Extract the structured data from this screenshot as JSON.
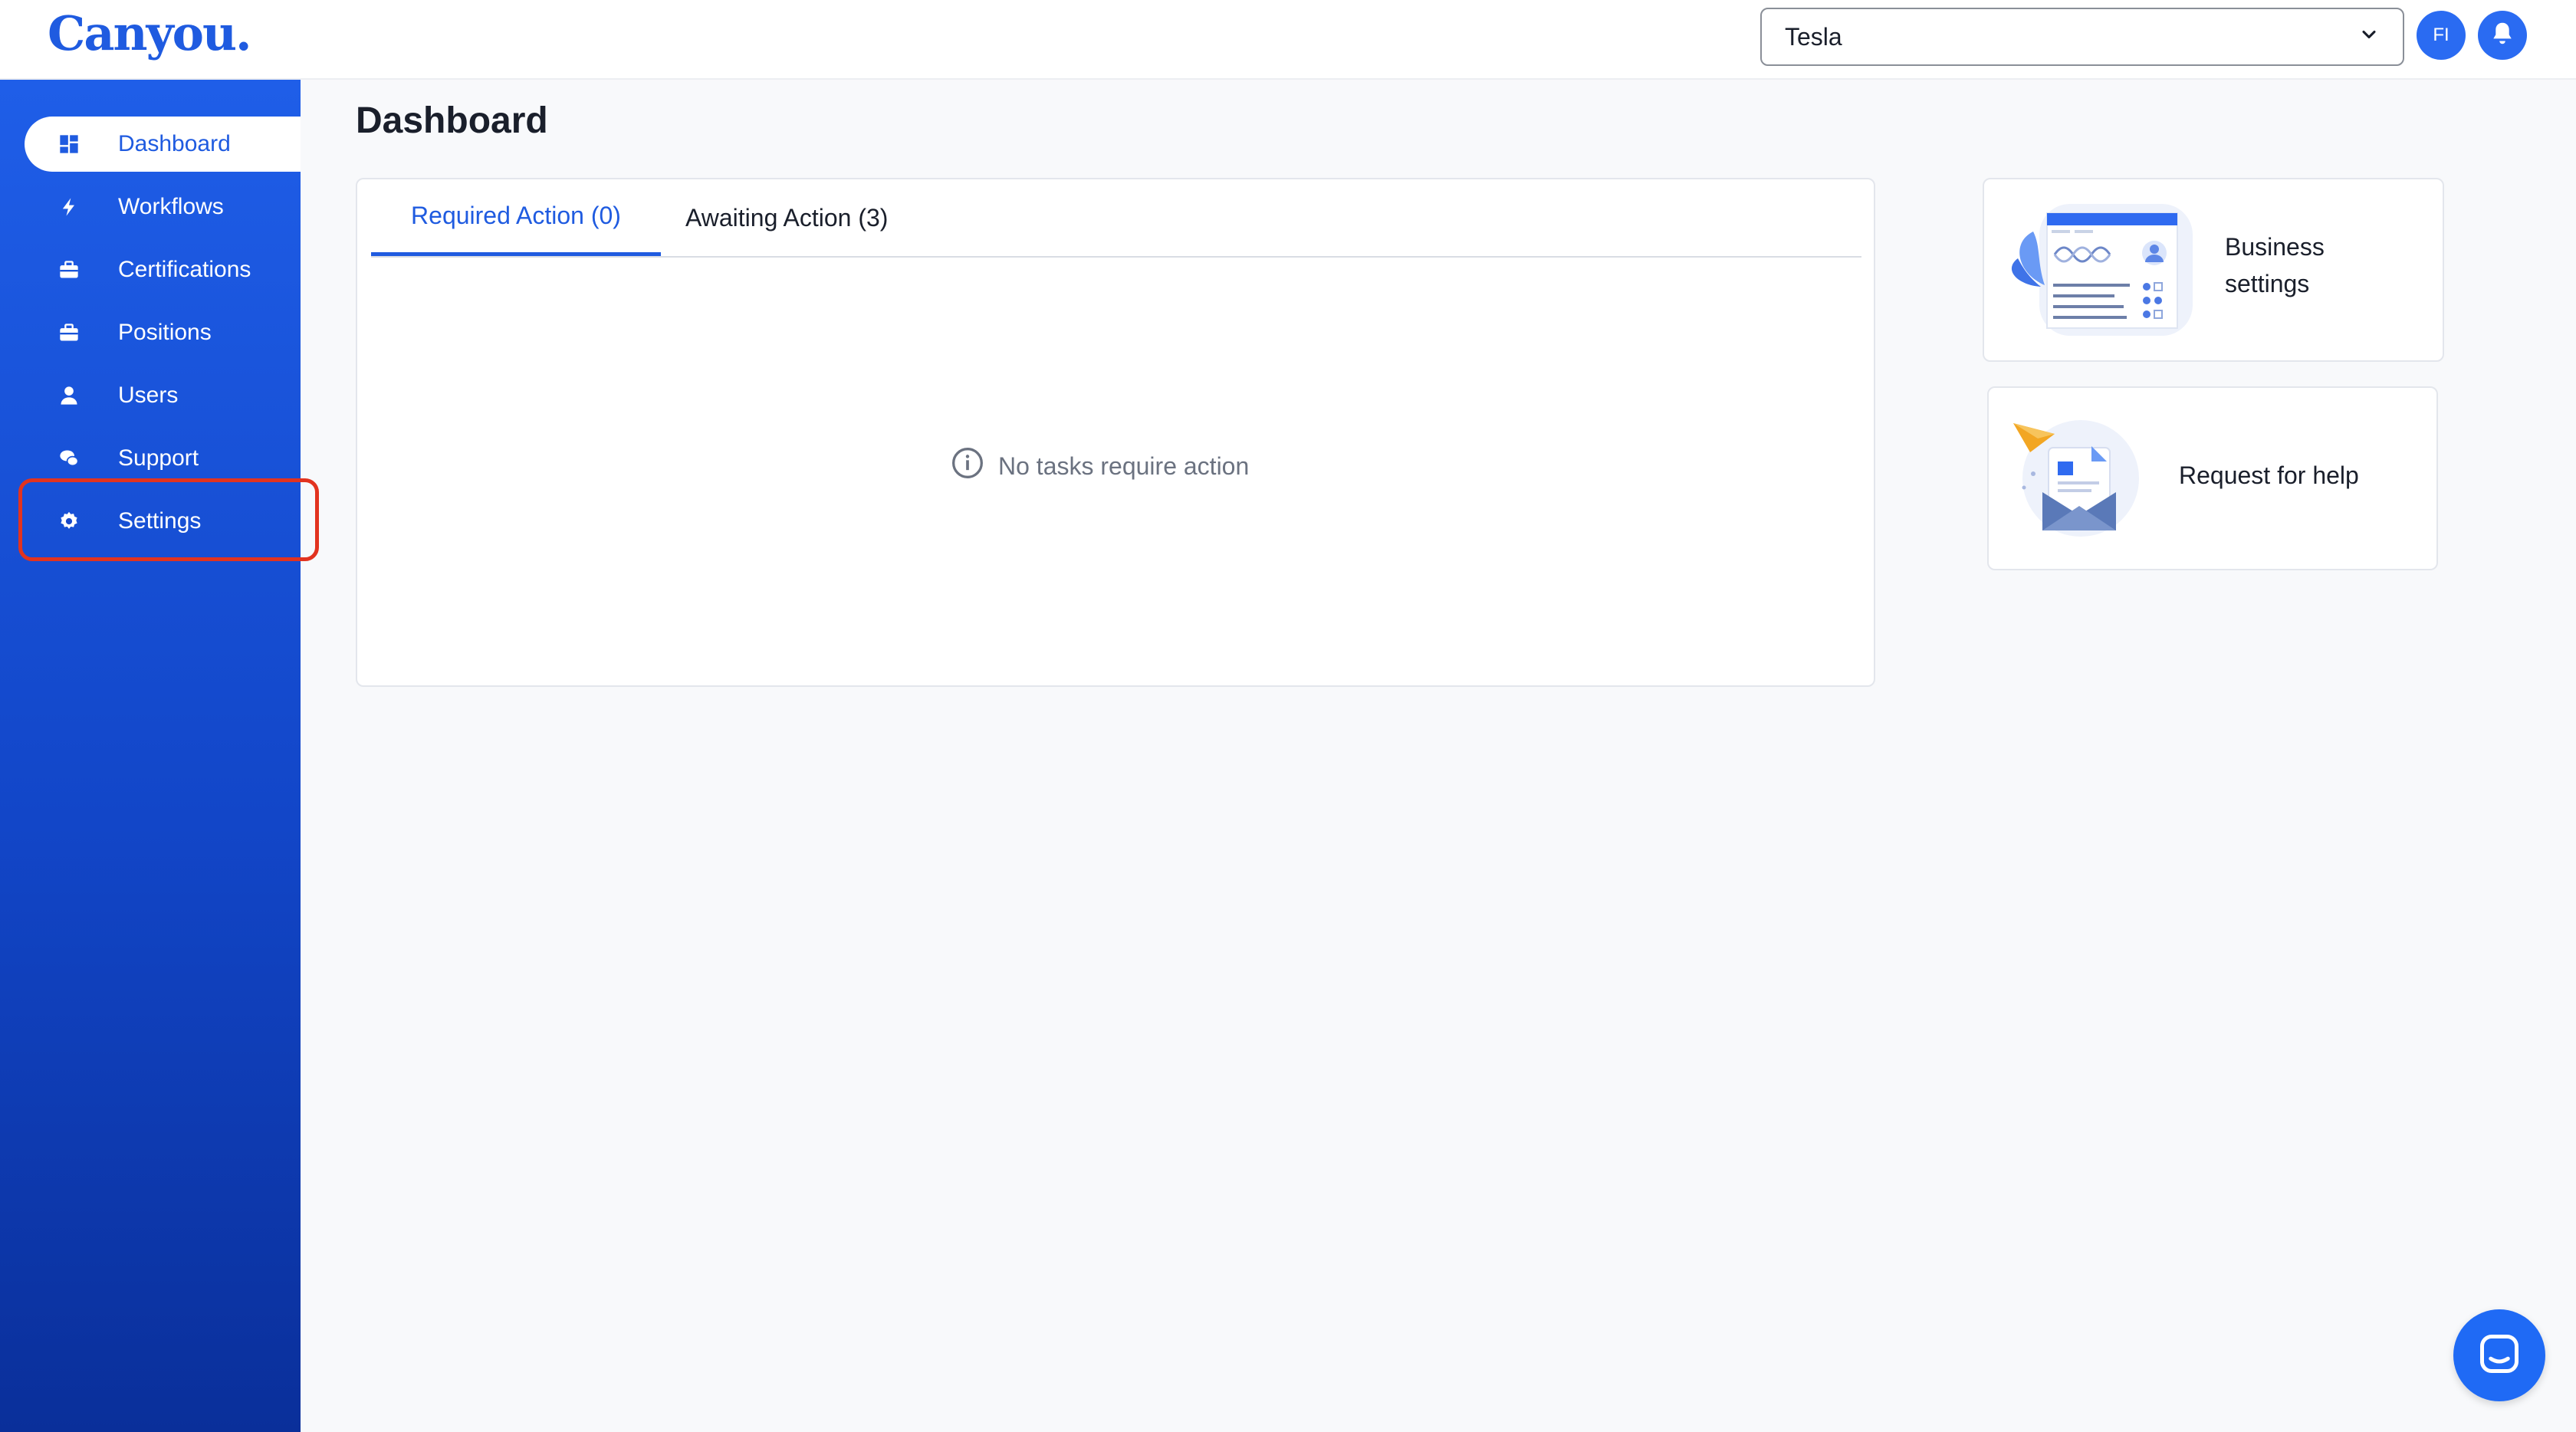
{
  "app": {
    "logo": "Canyou."
  },
  "header": {
    "org_select": {
      "value": "Tesla"
    },
    "avatar_initials": "FI"
  },
  "sidebar": {
    "items": [
      {
        "label": "Dashboard",
        "icon": "grid-icon",
        "active": true
      },
      {
        "label": "Workflows",
        "icon": "bolt-icon"
      },
      {
        "label": "Certifications",
        "icon": "briefcase-icon"
      },
      {
        "label": "Positions",
        "icon": "briefcase-icon"
      },
      {
        "label": "Users",
        "icon": "user-icon"
      },
      {
        "label": "Support",
        "icon": "chat-icon"
      },
      {
        "label": "Settings",
        "icon": "gear-icon",
        "highlighted": true
      }
    ]
  },
  "main": {
    "title": "Dashboard",
    "tabs": [
      {
        "label": "Required Action (0)",
        "active": true
      },
      {
        "label": "Awaiting Action (3)"
      }
    ],
    "empty_message": "No tasks require action"
  },
  "quick_links": {
    "business_settings": {
      "line1": "Business",
      "line2": "settings"
    },
    "request_help": {
      "label": "Request for help"
    }
  },
  "colors": {
    "brand": "#1f5be0",
    "highlight": "#e2331f"
  }
}
